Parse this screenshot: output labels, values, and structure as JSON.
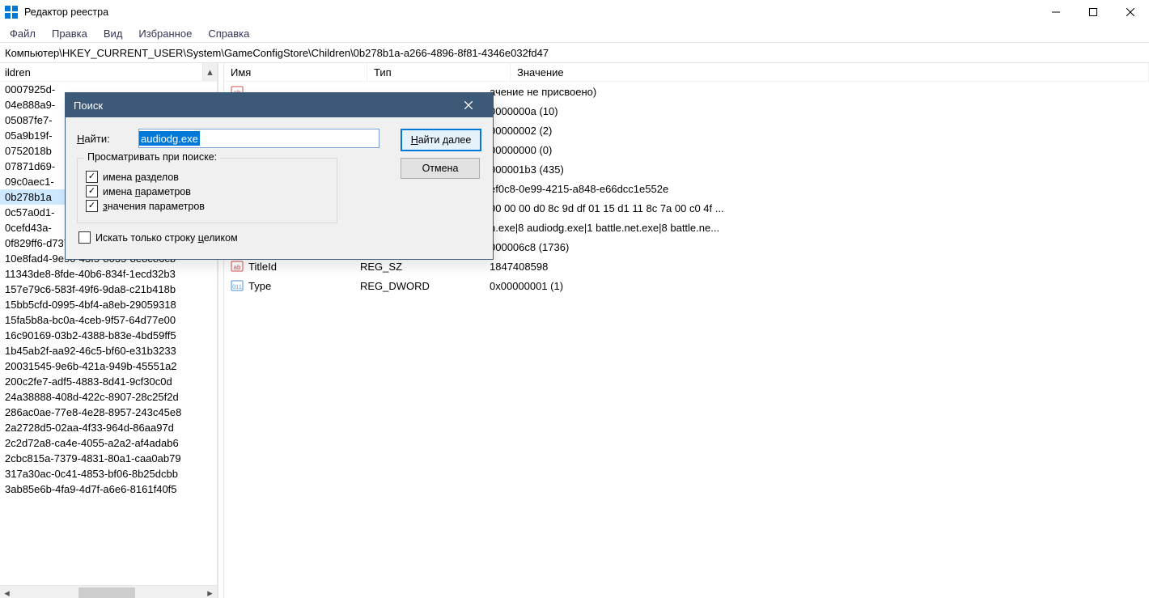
{
  "window": {
    "title": "Редактор реестра"
  },
  "menu": [
    "Файл",
    "Правка",
    "Вид",
    "Избранное",
    "Справка"
  ],
  "address": "Компьютер\\HKEY_CURRENT_USER\\System\\GameConfigStore\\Children\\0b278b1a-a266-4896-8f81-4346e032fd47",
  "tree": {
    "header": "ildren",
    "selected": "0b278b1a",
    "items": [
      "0007925d-",
      "04e888a9-",
      "05087fe7-",
      "05a9b19f-",
      "0752018b",
      "07871d69-",
      "09c0aec1-",
      "0b278b1a",
      "0c57a0d1-",
      "0cefd43a-",
      "0f829ff6-d737-4950-82aa-ec9478bb…",
      "10e8fad4-9e50-43f5-8035-8e8c86cb",
      "11343de8-8fde-40b6-834f-1ecd32b3",
      "157e79c6-583f-49f6-9da8-c21b418b",
      "15bb5cfd-0995-4bf4-a8eb-29059318",
      "15fa5b8a-bc0a-4ceb-9f57-64d77e00",
      "16c90169-03b2-4388-b83e-4bd59ff5",
      "1b45ab2f-aa92-46c5-bf60-e31b3233",
      "20031545-9e6b-421a-949b-45551a2",
      "200c2fe7-adf5-4883-8d41-9cf30c0d",
      "24a38888-408d-422c-8907-28c25f2d",
      "286ac0ae-77e8-4e28-8957-243c45e8",
      "2a2728d5-02aa-4f33-964d-86aa97d",
      "2c2d72a8-ca4e-4055-a2a2-af4adab6",
      "2cbc815a-7379-4831-80a1-caa0ab79",
      "317a30ac-0c41-4853-bf06-8b25dcbb",
      "3ab85e6b-4fa9-4d7f-a6e6-8161f40f5"
    ]
  },
  "values": {
    "columns": {
      "name": "Имя",
      "type": "Тип",
      "value": "Значение"
    },
    "rows": [
      {
        "icon": "sz",
        "name": "",
        "type": "",
        "value": "ачение не присвоено)"
      },
      {
        "icon": "dw",
        "name": "",
        "type": "",
        "value": "0000000a (10)"
      },
      {
        "icon": "dw",
        "name": "",
        "type": "",
        "value": "00000002 (2)"
      },
      {
        "icon": "dw",
        "name": "",
        "type": "",
        "value": "00000000 (0)"
      },
      {
        "icon": "dw",
        "name": "",
        "type": "",
        "value": "000001b3 (435)"
      },
      {
        "icon": "sz",
        "name": "",
        "type": "",
        "value": "ef0c8-0e99-4215-a848-e66dcc1e552e"
      },
      {
        "icon": "bin",
        "name": "",
        "type": "",
        "value": "00 00 00 d0 8c 9d df 01 15 d1 11 8c 7a 00 c0 4f ..."
      },
      {
        "icon": "sz",
        "name": "",
        "type": "",
        "value": "n.exe|8 audiodg.exe|1 battle.net.exe|8 battle.ne..."
      },
      {
        "icon": "dw",
        "name": "",
        "type": "",
        "value": "000006c8 (1736)"
      },
      {
        "icon": "sz",
        "name": "TitleId",
        "type": "REG_SZ",
        "value": "1847408598"
      },
      {
        "icon": "dw",
        "name": "Type",
        "type": "REG_DWORD",
        "value": "0x00000001 (1)"
      }
    ]
  },
  "dialog": {
    "title": "Поиск",
    "find_label_pre": "Н",
    "find_label_post": "айти:",
    "find_value": "audiodg.exe",
    "group_legend": "Просматривать при поиске:",
    "cb_keys_pre": "имена ",
    "cb_keys_u": "р",
    "cb_keys_post": "азделов",
    "cb_params_pre": "имена ",
    "cb_params_u": "п",
    "cb_params_post": "араметров",
    "cb_values_pre": "",
    "cb_values_u": "з",
    "cb_values_post": "начения параметров",
    "cb_whole_pre": "Искать только строку ",
    "cb_whole_u": "ц",
    "cb_whole_post": "еликом",
    "btn_find_pre": "",
    "btn_find_u": "Н",
    "btn_find_post": "айти далее",
    "btn_cancel": "Отмена"
  }
}
